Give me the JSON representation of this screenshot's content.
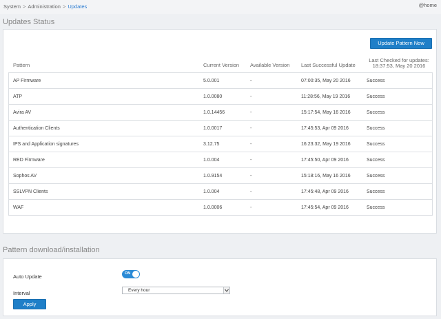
{
  "breadcrumb": {
    "items": [
      "System",
      "Administration",
      "Updates"
    ],
    "separator": ">"
  },
  "header": {
    "home_link": "@home"
  },
  "updates_status": {
    "title": "Updates Status",
    "update_button": "Update Pattern Now",
    "columns": [
      "Pattern",
      "Current Version",
      "Available Version",
      "Last Successful Update",
      "Last Checked for updates:",
      "18:37:53, May 20 2016"
    ],
    "rows": [
      {
        "pattern": "AP Firmware",
        "current": "5.0.001",
        "available": "-",
        "last_update": "07:00:35, May 20 2016",
        "status": "Success"
      },
      {
        "pattern": "ATP",
        "current": "1.0.0080",
        "available": "-",
        "last_update": "11:28:56, May 19 2016",
        "status": "Success"
      },
      {
        "pattern": "Avira AV",
        "current": "1.0.14456",
        "available": "-",
        "last_update": "15:17:54, May 16 2016",
        "status": "Success"
      },
      {
        "pattern": "Authentication Clients",
        "current": "1.0.0017",
        "available": "-",
        "last_update": "17:45:53, Apr 09 2016",
        "status": "Success"
      },
      {
        "pattern": "IPS and Application signatures",
        "current": "3.12.75",
        "available": "-",
        "last_update": "16:23:32, May 19 2016",
        "status": "Success"
      },
      {
        "pattern": "RED Firmware",
        "current": "1.0.004",
        "available": "-",
        "last_update": "17:45:50, Apr 09 2016",
        "status": "Success"
      },
      {
        "pattern": "Sophos AV",
        "current": "1.0.9154",
        "available": "-",
        "last_update": "15:18:16, May 16 2016",
        "status": "Success"
      },
      {
        "pattern": "SSLVPN Clients",
        "current": "1.0.004",
        "available": "-",
        "last_update": "17:45:48, Apr 09 2016",
        "status": "Success"
      },
      {
        "pattern": "WAF",
        "current": "1.0.0006",
        "available": "-",
        "last_update": "17:45:54, Apr 09 2016",
        "status": "Success"
      }
    ]
  },
  "pattern_download": {
    "title": "Pattern download/installation",
    "auto_update_label": "Auto Update",
    "auto_update_toggle": "ON",
    "interval_label": "Interval",
    "interval_value": "Every hour",
    "apply_button": "Apply"
  },
  "colors": {
    "accent": "#1f7fc8",
    "background": "#eef0f3",
    "panel": "#ffffff"
  }
}
